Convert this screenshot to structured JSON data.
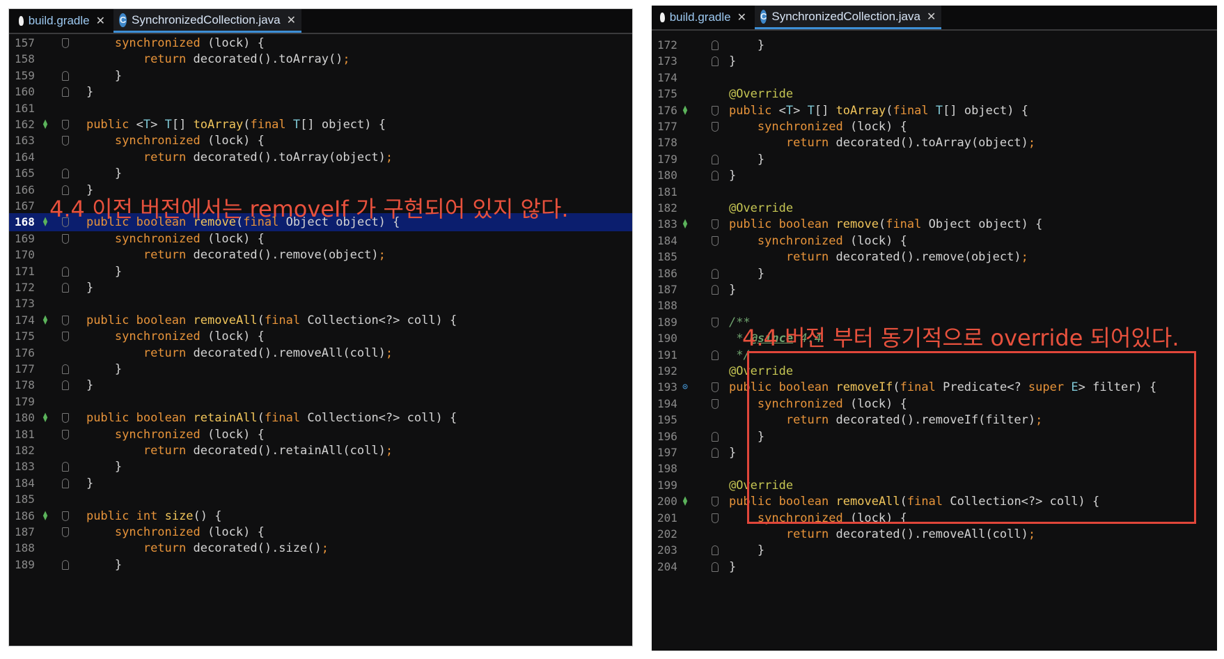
{
  "tabs": [
    {
      "label": "build.gradle",
      "icon": "gradle-elephant-icon"
    },
    {
      "label": "SynchronizedCollection.java",
      "icon": "java-class-icon"
    }
  ],
  "left": {
    "annotation": "4.4 이전 버전에서는 removeIf 가 구현되어 있지 않다.",
    "lines": [
      {
        "n": "157",
        "code": "        synchronized (lock) {"
      },
      {
        "n": "158",
        "code": "            return decorated().toArray();"
      },
      {
        "n": "159",
        "code": "        }"
      },
      {
        "n": "160",
        "code": "    }"
      },
      {
        "n": "161",
        "code": ""
      },
      {
        "n": "162",
        "code": "    public <T> T[] toArray(final T[] object) {"
      },
      {
        "n": "163",
        "code": "        synchronized (lock) {"
      },
      {
        "n": "164",
        "code": "            return decorated().toArray(object);"
      },
      {
        "n": "165",
        "code": "        }"
      },
      {
        "n": "166",
        "code": "    }"
      },
      {
        "n": "167",
        "code": ""
      },
      {
        "n": "168",
        "code": "    public boolean remove(final Object object) {"
      },
      {
        "n": "169",
        "code": "        synchronized (lock) {"
      },
      {
        "n": "170",
        "code": "            return decorated().remove(object);"
      },
      {
        "n": "171",
        "code": "        }"
      },
      {
        "n": "172",
        "code": "    }"
      },
      {
        "n": "173",
        "code": ""
      },
      {
        "n": "174",
        "code": "    public boolean removeAll(final Collection<?> coll) {"
      },
      {
        "n": "175",
        "code": "        synchronized (lock) {"
      },
      {
        "n": "176",
        "code": "            return decorated().removeAll(coll);"
      },
      {
        "n": "177",
        "code": "        }"
      },
      {
        "n": "178",
        "code": "    }"
      },
      {
        "n": "179",
        "code": ""
      },
      {
        "n": "180",
        "code": "    public boolean retainAll(final Collection<?> coll) {"
      },
      {
        "n": "181",
        "code": "        synchronized (lock) {"
      },
      {
        "n": "182",
        "code": "            return decorated().retainAll(coll);"
      },
      {
        "n": "183",
        "code": "        }"
      },
      {
        "n": "184",
        "code": "    }"
      },
      {
        "n": "185",
        "code": ""
      },
      {
        "n": "186",
        "code": "    public int size() {"
      },
      {
        "n": "187",
        "code": "        synchronized (lock) {"
      },
      {
        "n": "188",
        "code": "            return decorated().size();"
      },
      {
        "n": "189",
        "code": "        }"
      }
    ]
  },
  "right": {
    "annotation": "4.4 버전 부터 동기적으로 override 되어있다.",
    "lines": [
      {
        "n": "172",
        "code": "        }"
      },
      {
        "n": "173",
        "code": "    }"
      },
      {
        "n": "174",
        "code": ""
      },
      {
        "n": "175",
        "code": "    @Override"
      },
      {
        "n": "176",
        "code": "    public <T> T[] toArray(final T[] object) {"
      },
      {
        "n": "177",
        "code": "        synchronized (lock) {"
      },
      {
        "n": "178",
        "code": "            return decorated().toArray(object);"
      },
      {
        "n": "179",
        "code": "        }"
      },
      {
        "n": "180",
        "code": "    }"
      },
      {
        "n": "181",
        "code": ""
      },
      {
        "n": "182",
        "code": "    @Override"
      },
      {
        "n": "183",
        "code": "    public boolean remove(final Object object) {"
      },
      {
        "n": "184",
        "code": "        synchronized (lock) {"
      },
      {
        "n": "185",
        "code": "            return decorated().remove(object);"
      },
      {
        "n": "186",
        "code": "        }"
      },
      {
        "n": "187",
        "code": "    }"
      },
      {
        "n": "188",
        "code": ""
      },
      {
        "n": "189",
        "code": "    /**"
      },
      {
        "n": "190",
        "code": "     * @since 4.4"
      },
      {
        "n": "191",
        "code": "     */"
      },
      {
        "n": "192",
        "code": "    @Override"
      },
      {
        "n": "193",
        "code": "    public boolean removeIf(final Predicate<? super E> filter) {"
      },
      {
        "n": "194",
        "code": "        synchronized (lock) {"
      },
      {
        "n": "195",
        "code": "            return decorated().removeIf(filter);"
      },
      {
        "n": "196",
        "code": "        }"
      },
      {
        "n": "197",
        "code": "    }"
      },
      {
        "n": "198",
        "code": ""
      },
      {
        "n": "199",
        "code": "    @Override"
      },
      {
        "n": "200",
        "code": "    public boolean removeAll(final Collection<?> coll) {"
      },
      {
        "n": "201",
        "code": "        synchronized (lock) {"
      },
      {
        "n": "202",
        "code": "            return decorated().removeAll(coll);"
      },
      {
        "n": "203",
        "code": "        }"
      },
      {
        "n": "204",
        "code": "    }"
      }
    ]
  },
  "colors": {
    "editor_bg": "#0f0f10",
    "current_line": "#0b1e6e",
    "annotation": "#e8513d",
    "keyword": "#e8943a",
    "method": "#f2c65b",
    "annotation_syntax": "#c6c653",
    "comment": "#6fa36e"
  }
}
